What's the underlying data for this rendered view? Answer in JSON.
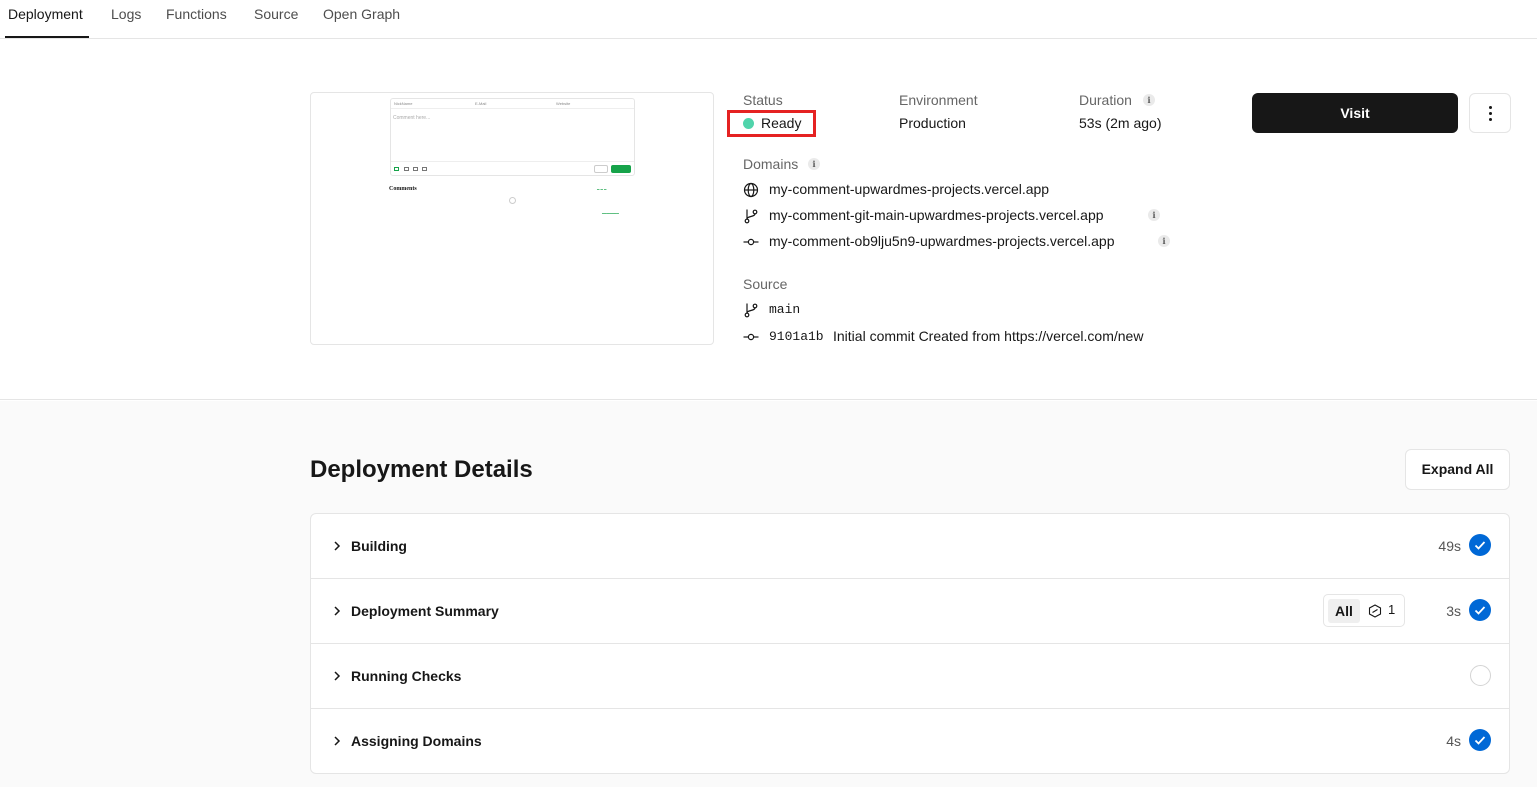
{
  "tabs": [
    {
      "label": "Deployment"
    },
    {
      "label": "Logs"
    },
    {
      "label": "Functions"
    },
    {
      "label": "Source"
    },
    {
      "label": "Open Graph"
    }
  ],
  "preview": {
    "field_name": "NickName",
    "field_email": "E-Mail",
    "field_website": "Website",
    "placeholder": "Comment here...",
    "comments_title": "Comments"
  },
  "status": {
    "label": "Status",
    "value": "Ready",
    "dot_color": "#50d4ab"
  },
  "environment": {
    "label": "Environment",
    "value": "Production"
  },
  "duration": {
    "label": "Duration",
    "value": "53s (2m ago)"
  },
  "domains": {
    "label": "Domains",
    "items": [
      {
        "icon": "globe-icon",
        "text": "my-comment-upwardmes-projects.vercel.app"
      },
      {
        "icon": "git-branch-icon",
        "text": "my-comment-git-main-upwardmes-projects.vercel.app"
      },
      {
        "icon": "git-commit-icon",
        "text": "my-comment-ob9lju5n9-upwardmes-projects.vercel.app"
      }
    ]
  },
  "source": {
    "label": "Source",
    "branch": "main",
    "commit_hash": "9101a1b",
    "commit_message": "Initial commit Created from https://vercel.com/new"
  },
  "actions": {
    "visit_label": "Visit"
  },
  "details": {
    "title": "Deployment Details",
    "expand_label": "Expand All",
    "steps": [
      {
        "label": "Building",
        "time": "49s",
        "state": "done"
      },
      {
        "label": "Deployment Summary",
        "time": "3s",
        "state": "done",
        "filter_all": "All",
        "filter_count": "1"
      },
      {
        "label": "Running Checks",
        "time": "",
        "state": "pending"
      },
      {
        "label": "Assigning Domains",
        "time": "4s",
        "state": "done"
      }
    ]
  }
}
